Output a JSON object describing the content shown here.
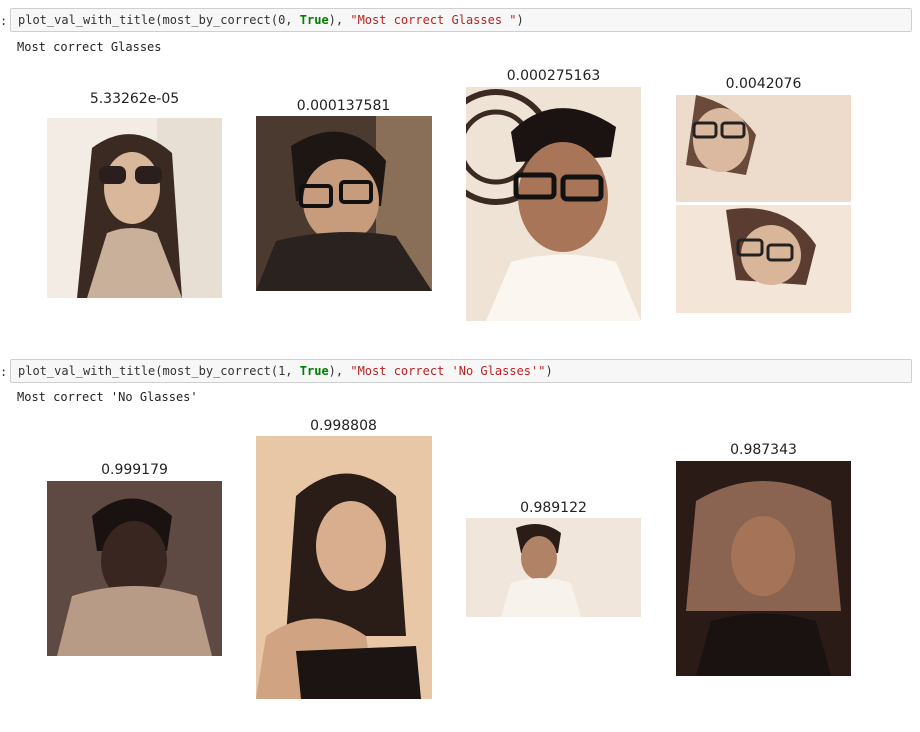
{
  "cells": [
    {
      "prompt": ":",
      "code": {
        "func": "plot_val_with_title(most_by_correct(0, ",
        "keyword": "True",
        "mid": "), ",
        "string": "\"Most correct Glasses \"",
        "end": ")"
      },
      "output_text": "Most correct Glasses",
      "images": [
        {
          "title": "5.33262e-05",
          "subject": "woman-with-sunglasses"
        },
        {
          "title": "0.000137581",
          "subject": "man-with-glasses"
        },
        {
          "title": "0.000275163",
          "subject": "man-with-glasses-white-shirt"
        },
        {
          "title": "0.0042076",
          "subject": "woman-with-glasses-collage"
        }
      ]
    },
    {
      "prompt": ":",
      "code": {
        "func": "plot_val_with_title(most_by_correct(1, ",
        "keyword": "True",
        "mid": "), ",
        "string": "\"Most correct 'No Glasses'\"",
        "end": ")"
      },
      "output_text": "Most correct 'No Glasses'",
      "images": [
        {
          "title": "0.999179",
          "subject": "woman-short-hair"
        },
        {
          "title": "0.998808",
          "subject": "woman-long-dark-hair"
        },
        {
          "title": "0.989122",
          "subject": "man-smiling"
        },
        {
          "title": "0.987343",
          "subject": "woman-curly-hair"
        }
      ]
    }
  ]
}
